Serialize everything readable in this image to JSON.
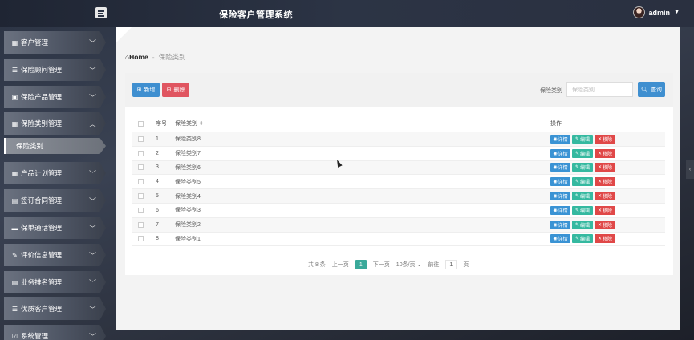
{
  "header": {
    "title": "保险客户管理系统",
    "user": "admin"
  },
  "sidebar": {
    "items": [
      {
        "label": "客户管理",
        "icon": "grid-icon"
      },
      {
        "label": "保险顾问管理",
        "icon": "list-icon"
      },
      {
        "label": "保险产品管理",
        "icon": "briefcase-icon"
      },
      {
        "label": "保险类别管理",
        "icon": "table-icon",
        "expanded": true
      },
      {
        "label": "产品计划管理",
        "icon": "grid-icon"
      },
      {
        "label": "签订合同管理",
        "icon": "clipboard-icon"
      },
      {
        "label": "保单通话管理",
        "icon": "comment-icon"
      },
      {
        "label": "评价信息管理",
        "icon": "edit-icon"
      },
      {
        "label": "业务排名管理",
        "icon": "clipboard-icon"
      },
      {
        "label": "优质客户管理",
        "icon": "list-icon"
      },
      {
        "label": "系统管理",
        "icon": "check-square-icon"
      }
    ],
    "sub_item": "保险类别"
  },
  "breadcrumb": {
    "home": "Home",
    "separator": "-",
    "current": "保险类别"
  },
  "toolbar": {
    "add_label": "新增",
    "delete_label": "删除",
    "search_label": "保险类别",
    "search_placeholder": "保险类别",
    "search_button": "查询"
  },
  "table": {
    "headers": {
      "no": "序号",
      "name": "保险类别",
      "ops": "操作"
    },
    "rows": [
      {
        "no": "1",
        "name": "保险类别8"
      },
      {
        "no": "2",
        "name": "保险类别7"
      },
      {
        "no": "3",
        "name": "保险类别6"
      },
      {
        "no": "4",
        "name": "保险类别5"
      },
      {
        "no": "5",
        "name": "保险类别4"
      },
      {
        "no": "6",
        "name": "保险类别3"
      },
      {
        "no": "7",
        "name": "保险类别2"
      },
      {
        "no": "8",
        "name": "保险类别1"
      }
    ],
    "op_labels": {
      "detail": "详情",
      "edit": "编辑",
      "remove": "移除"
    }
  },
  "pager": {
    "total": "共 8 条",
    "prev": "上一页",
    "current": "1",
    "next": "下一页",
    "page_size": "10条/页",
    "goto": "前往",
    "goto_page": "1",
    "page_unit": "页"
  },
  "colors": {
    "primary": "#3f8fd0",
    "danger": "#e05560",
    "success": "#35b9a0",
    "pager_active": "#3aa99a"
  }
}
